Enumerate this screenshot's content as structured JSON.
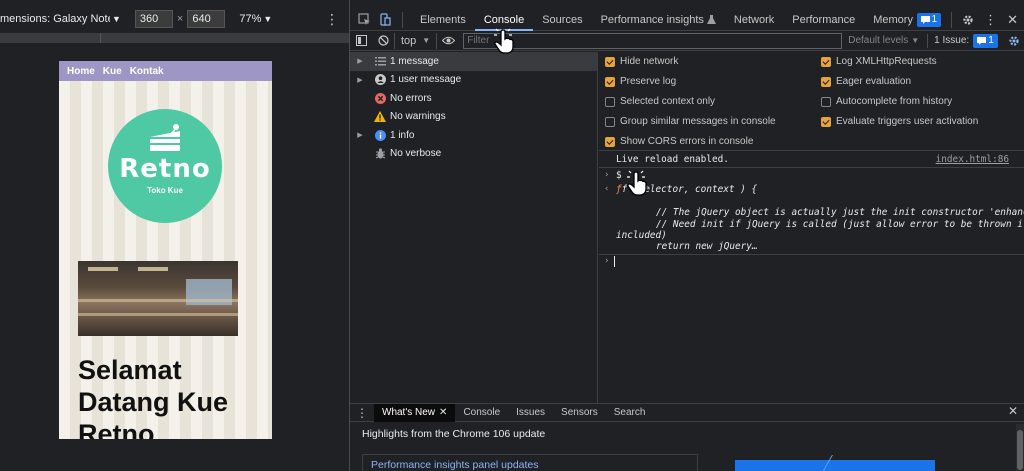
{
  "device_toolbar": {
    "dimensions_label": "mensions: Galaxy Note…",
    "width": "360",
    "height": "640",
    "separator": "×",
    "zoom": "77%"
  },
  "preview": {
    "nav": [
      "Home",
      "Kue",
      "Kontak"
    ],
    "logo_title": "Retno",
    "logo_subtitle": "Toko Kue",
    "headline": "Selamat Datang Kue Retno"
  },
  "devtools": {
    "tabs": [
      "Elements",
      "Console",
      "Sources",
      "Performance insights",
      "Network",
      "Performance",
      "Memory"
    ],
    "active_tab": "Console",
    "more": "»",
    "message_badge": "1",
    "toolbar": {
      "context": "top",
      "filter_placeholder": "Filter",
      "levels": "Default levels",
      "issues_label": "1 Issue:",
      "issues_count": "1"
    },
    "sidebar": [
      {
        "label": "1 message",
        "icon": "list-icon",
        "arrow": true
      },
      {
        "label": "1 user message",
        "icon": "user-icon",
        "arrow": true
      },
      {
        "label": "No errors",
        "icon": "error-icon",
        "arrow": false
      },
      {
        "label": "No warnings",
        "icon": "warning-icon",
        "arrow": false
      },
      {
        "label": "1 info",
        "icon": "info-icon",
        "arrow": true
      },
      {
        "label": "No verbose",
        "icon": "bug-icon",
        "arrow": false
      }
    ],
    "settings": {
      "left": [
        {
          "label": "Hide network",
          "checked": true
        },
        {
          "label": "Preserve log",
          "checked": true
        },
        {
          "label": "Selected context only",
          "checked": false
        },
        {
          "label": "Group similar messages in console",
          "checked": false
        },
        {
          "label": "Show CORS errors in console",
          "checked": true
        }
      ],
      "right": [
        {
          "label": "Log XMLHttpRequests",
          "checked": true
        },
        {
          "label": "Eager evaluation",
          "checked": true
        },
        {
          "label": "Autocomplete from history",
          "checked": false
        },
        {
          "label": "Evaluate triggers user activation",
          "checked": true
        }
      ]
    },
    "console": {
      "reload_msg": "Live reload enabled.",
      "reload_src": "index.html:86",
      "input_cmd": "$ ",
      "result_head": "f (selector, context ) {",
      "comment1": "// The jQuery object is actually just the init constructor 'enhanced'",
      "comment2": "// Need init if jQuery is called (just allow error to be thrown if not",
      "comment2b": "included)",
      "return_line": "return new jQuery…"
    },
    "drawer": {
      "tabs": [
        "What's New",
        "Console",
        "Issues",
        "Sensors",
        "Search"
      ],
      "highlights": "Highlights from the Chrome 106 update",
      "card_title": "Performance insights panel updates"
    }
  },
  "colors": {
    "accent_blue": "#1a73e8",
    "checkbox_orange": "#e8a33a",
    "logo_green": "#4fc9a3",
    "nav_purple": "#9e97c5"
  }
}
